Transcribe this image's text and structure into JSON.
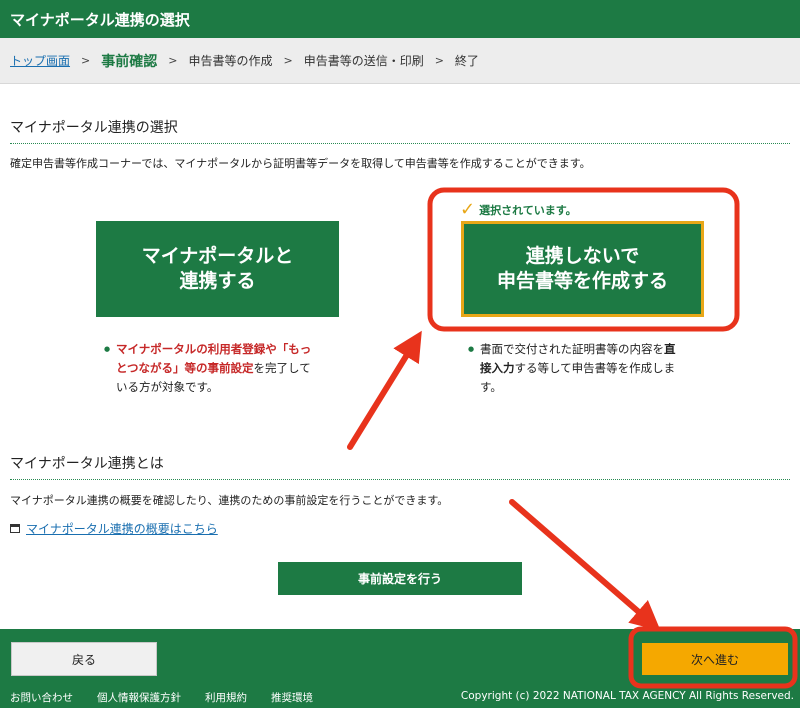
{
  "window": {
    "title": "マイナポータル連携の選択"
  },
  "breadcrumb": {
    "items": [
      {
        "label": "トップ画面"
      },
      {
        "label": "事前確認"
      },
      {
        "label": "申告書等の作成"
      },
      {
        "label": "申告書等の送信・印刷"
      },
      {
        "label": "終了"
      }
    ],
    "separator": ">"
  },
  "main": {
    "heading": "マイナポータル連携の選択",
    "description": "確定申告書等作成コーナーでは、マイナポータルから証明書等データを取得して申告書等を作成することができます。",
    "selected_note": "選択されています。",
    "option_link": {
      "label": "マイナポータルと\n連携する",
      "bullet_red": "マイナポータルの利用者登録や「もっとつながる」等の事前設定",
      "bullet_rest": "を完了している方が対象です。"
    },
    "option_nolink": {
      "label": "連携しないで\n申告書等を作成する",
      "bullet_pre": "書面で交付された証明書等の内容を",
      "bullet_bold": "直接入力",
      "bullet_post": "する等して申告書等を作成します。"
    }
  },
  "about": {
    "heading": "マイナポータル連携とは",
    "description": "マイナポータル連携の概要を確認したり、連携のための事前設定を行うことができます。",
    "link": "マイナポータル連携の概要はこちら",
    "button": "事前設定を行う"
  },
  "footer": {
    "back": "戻る",
    "next": "次へ進む",
    "links": [
      "お問い合わせ",
      "個人情報保護方針",
      "利用規約",
      "推奨環境"
    ],
    "copyright": "Copyright (c) 2022 NATIONAL TAX AGENCY All Rights Reserved."
  },
  "colors": {
    "brand_green": "#1d7a44",
    "accent_orange": "#f5a800",
    "highlight_red": "#e8331c",
    "link_blue": "#1a6fb0"
  },
  "icons": [
    "check-icon",
    "external-window-icon"
  ]
}
